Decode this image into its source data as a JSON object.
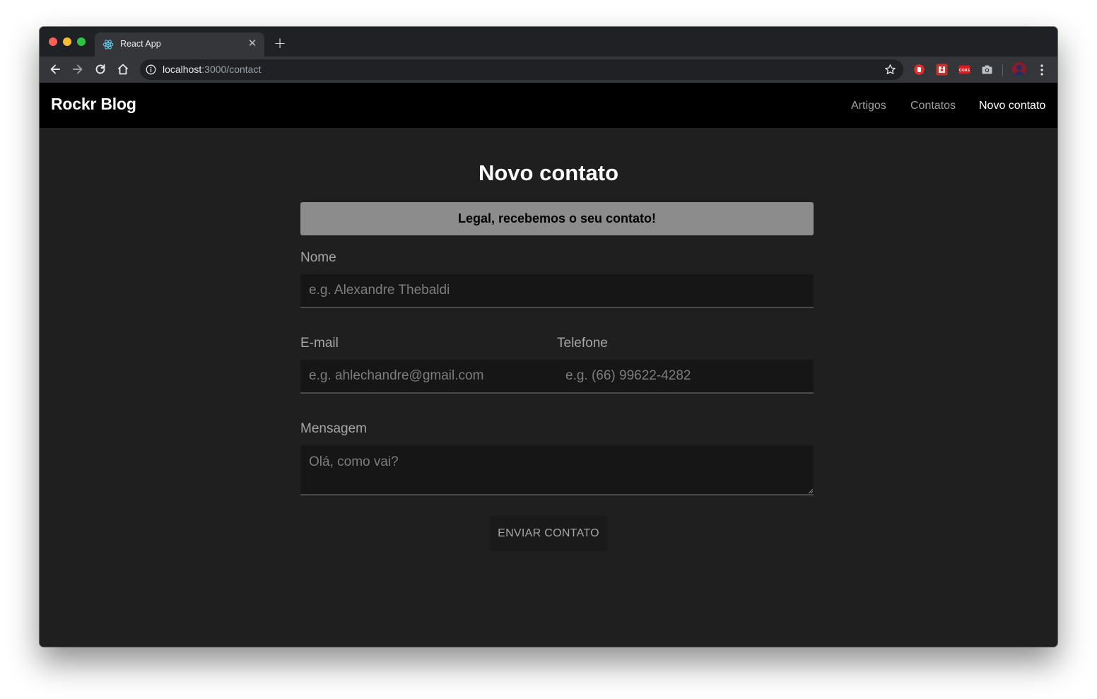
{
  "browser": {
    "tab_title": "React App",
    "url_host": "localhost",
    "url_path": ":3000/contact"
  },
  "navbar": {
    "brand": "Rockr Blog",
    "links": [
      {
        "label": "Artigos",
        "active": false
      },
      {
        "label": "Contatos",
        "active": false
      },
      {
        "label": "Novo contato",
        "active": true
      }
    ]
  },
  "form": {
    "title": "Novo contato",
    "success_message": "Legal, recebemos o seu contato!",
    "name_label": "Nome",
    "name_placeholder": "e.g. Alexandre Thebaldi",
    "email_label": "E-mail",
    "email_placeholder": "e.g. ahlechandre@gmail.com",
    "phone_label": "Telefone",
    "phone_placeholder": "e.g. (66) 99622-4282",
    "message_label": "Mensagem",
    "message_placeholder": "Olá, como vai?",
    "submit_label": "ENVIAR CONTATO"
  },
  "colors": {
    "navbar_bg": "#000000",
    "page_bg": "#1f1f1f",
    "alert_bg": "#8c8c8c"
  }
}
